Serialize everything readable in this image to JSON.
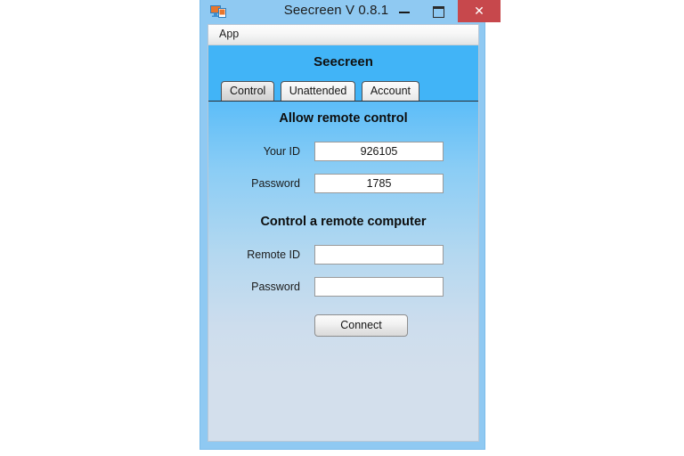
{
  "window": {
    "title": "Seecreen V 0.8.1",
    "icon": "remote-desktop-icon",
    "controls": {
      "minimize": "–",
      "maximize": "❐",
      "close": "✕"
    },
    "close_color": "#c7484c",
    "frame_color": "#8fc9f2"
  },
  "menubar": {
    "items": [
      {
        "label": "App"
      }
    ]
  },
  "banner": {
    "title": "Seecreen",
    "color": "#41b4f7"
  },
  "tabs": [
    {
      "label": "Control",
      "selected": true
    },
    {
      "label": "Unattended",
      "selected": false
    },
    {
      "label": "Account",
      "selected": false
    }
  ],
  "panel": {
    "allow_section": {
      "title": "Allow remote control",
      "fields": [
        {
          "label": "Your ID",
          "value": "926105",
          "placeholder": ""
        },
        {
          "label": "Password",
          "value": "1785",
          "placeholder": ""
        }
      ]
    },
    "control_section": {
      "title": "Control a remote computer",
      "fields": [
        {
          "label": "Remote ID",
          "value": "",
          "placeholder": ""
        },
        {
          "label": "Password",
          "value": "",
          "placeholder": ""
        }
      ],
      "connect_button": "Connect"
    }
  }
}
